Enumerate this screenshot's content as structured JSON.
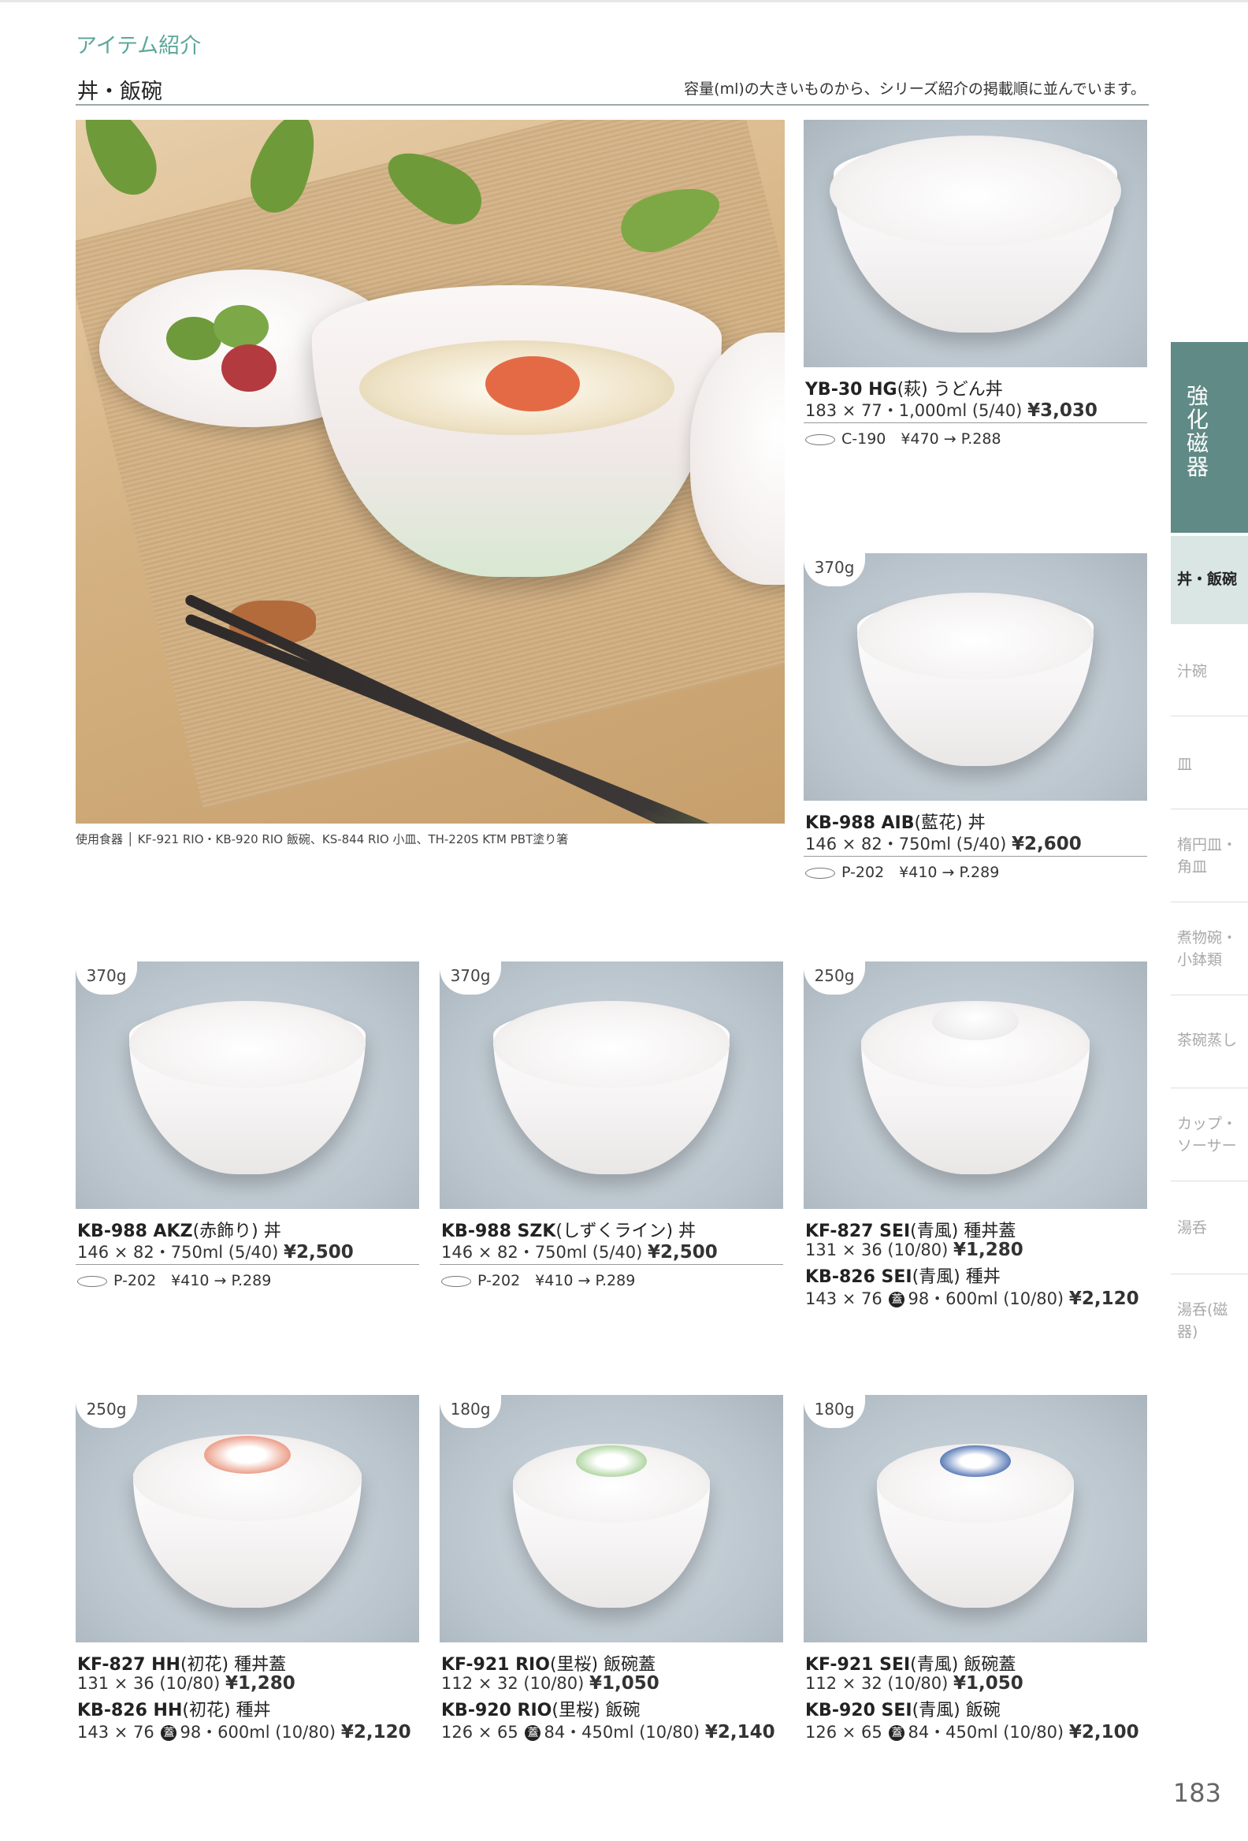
{
  "header": {
    "section_title": "アイテム紹介",
    "page_heading": "丼・飯碗",
    "subtitle": "容量(ml)の大きいものから、シリーズ紹介の掲載順に並んでいます。"
  },
  "hero": {
    "caption": "使用食器 │ KF-921 RIO・KB-920 RIO 飯碗、KS-844 RIO 小皿、TH-220S KTM PBT塗り箸"
  },
  "products": [
    {
      "weight": "",
      "name1": "YB-30 HG",
      "jp1": "(萩) うどん丼",
      "spec1": "183 × 77・1,000ml (5/40)",
      "price1": "¥3,030",
      "sub": "C-190　¥470 → P.288"
    },
    {
      "weight": "370g",
      "name1": "KB-988 AIB",
      "jp1": "(藍花) 丼",
      "spec1": "146 × 82・750ml (5/40)",
      "price1": "¥2,600",
      "sub": "P-202　¥410 → P.289"
    },
    {
      "weight": "370g",
      "name1": "KB-988 AKZ",
      "jp1": "(赤飾り) 丼",
      "spec1": "146 × 82・750ml (5/40)",
      "price1": "¥2,500",
      "sub": "P-202　¥410 → P.289"
    },
    {
      "weight": "370g",
      "name1": "KB-988 SZK",
      "jp1": "(しずくライン) 丼",
      "spec1": "146 × 82・750ml (5/40)",
      "price1": "¥2,500",
      "sub": "P-202　¥410 → P.289"
    },
    {
      "weight": "250g",
      "name1": "KF-827 SEI",
      "jp1": "(青風) 種丼蓋",
      "spec1": "131 × 36 (10/80)",
      "price1": "¥1,280",
      "name2": "KB-826 SEI",
      "jp2": "(青風) 種丼",
      "spec2a": "143 × 76",
      "lid": "蓋",
      "spec2b": "98・600ml (10/80)",
      "price2": "¥2,120"
    },
    {
      "weight": "250g",
      "name1": "KF-827 HH",
      "jp1": "(初花) 種丼蓋",
      "spec1": "131 × 36 (10/80)",
      "price1": "¥1,280",
      "name2": "KB-826 HH",
      "jp2": "(初花) 種丼",
      "spec2a": "143 × 76",
      "lid": "蓋",
      "spec2b": "98・600ml (10/80)",
      "price2": "¥2,120"
    },
    {
      "weight": "180g",
      "name1": "KF-921 RIO",
      "jp1": "(里桜) 飯碗蓋",
      "spec1": "112 × 32 (10/80)",
      "price1": "¥1,050",
      "name2": "KB-920 RIO",
      "jp2": "(里桜) 飯碗",
      "spec2a": "126 × 65",
      "lid": "蓋",
      "spec2b": "84・450ml (10/80)",
      "price2": "¥2,140"
    },
    {
      "weight": "180g",
      "name1": "KF-921 SEI",
      "jp1": "(青風) 飯碗蓋",
      "spec1": "112 × 32 (10/80)",
      "price1": "¥1,050",
      "name2": "KB-920 SEI",
      "jp2": "(青風) 飯碗",
      "spec2a": "126 × 65",
      "lid": "蓋",
      "spec2b": "84・450ml (10/80)",
      "price2": "¥2,100"
    }
  ],
  "sidebar": {
    "category": "強化磁器",
    "current": "丼・飯碗",
    "items": [
      "汁碗",
      "皿",
      "楕円皿・角皿",
      "煮物碗・小鉢類",
      "茶碗蒸し",
      "カップ・ソーサー",
      "湯呑",
      "湯呑(磁器)"
    ]
  },
  "page_number": "183",
  "colors": {
    "accent": "#5f8a86",
    "section_title": "#5ca79b",
    "photo_bg": "#b9c4cc"
  }
}
